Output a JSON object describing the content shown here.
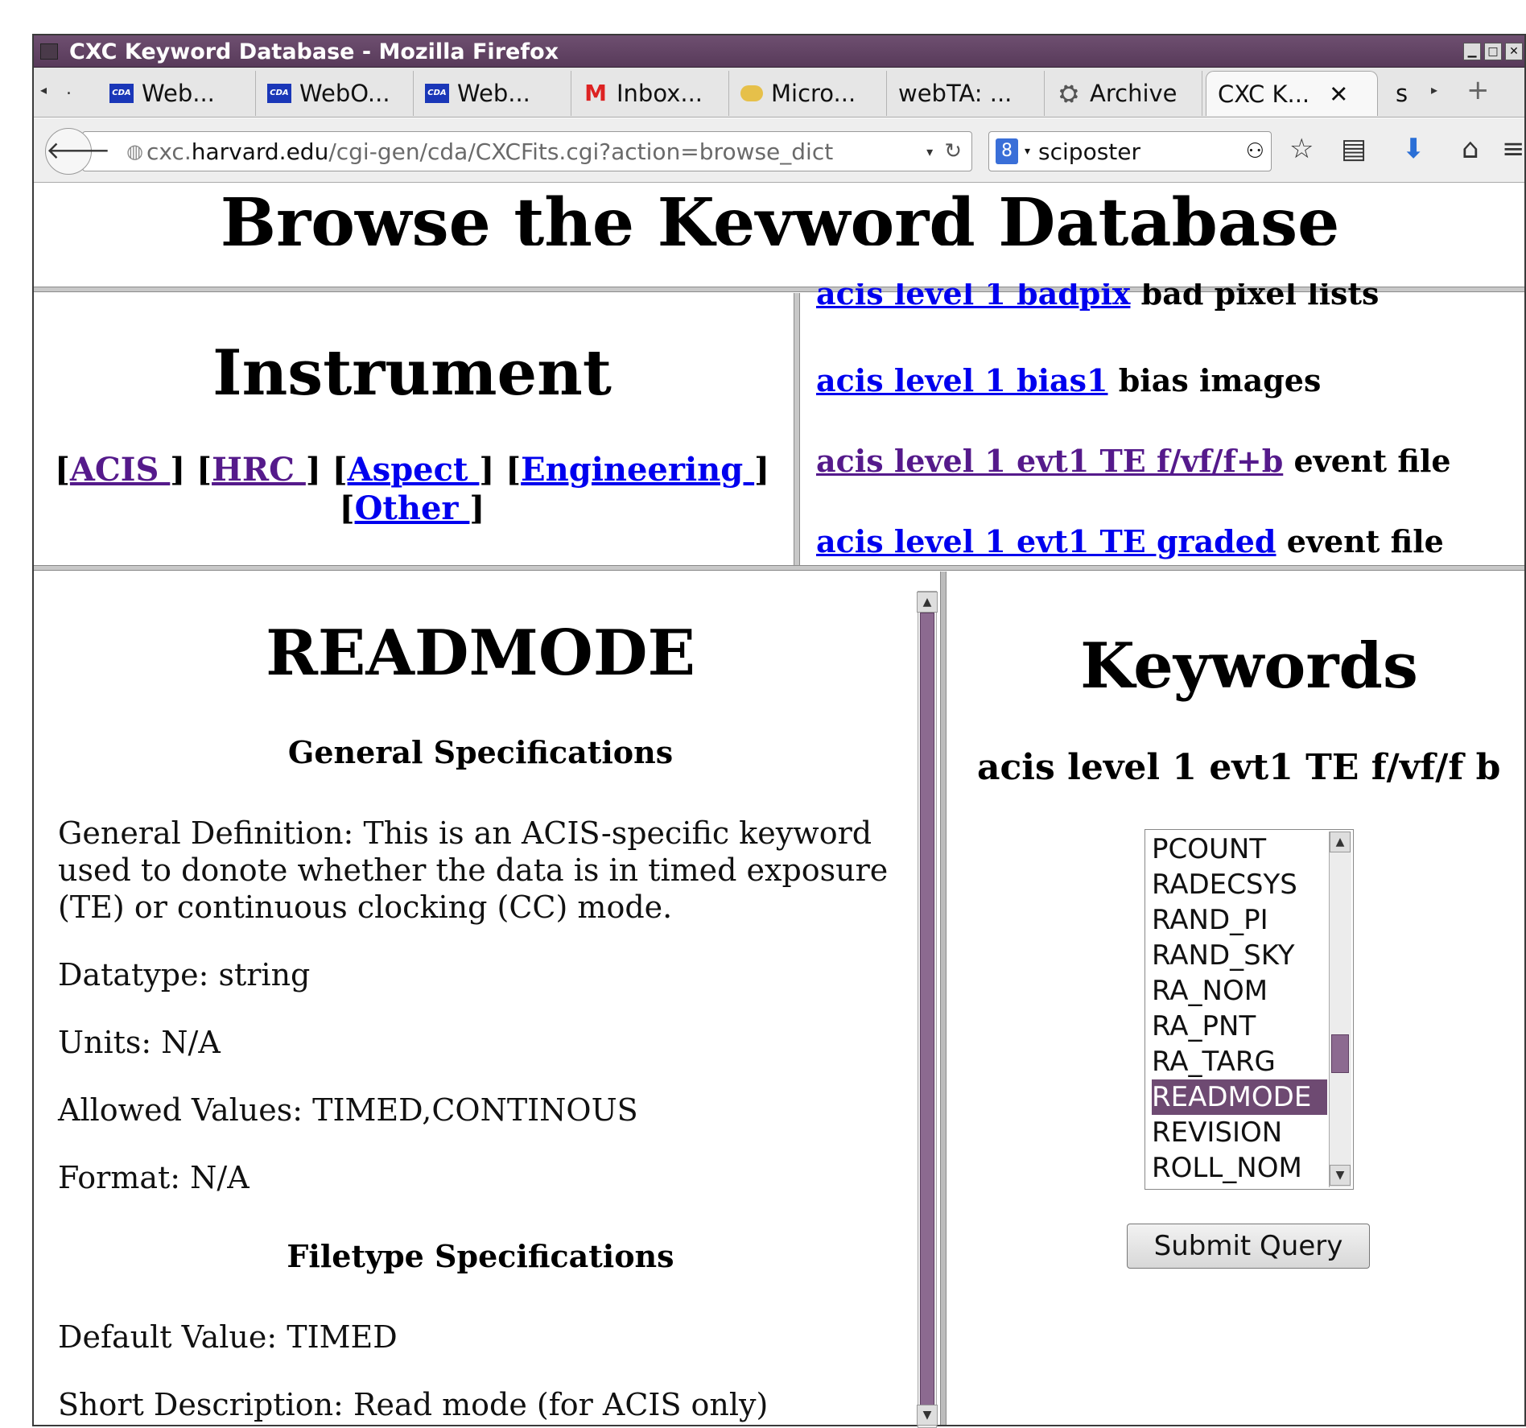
{
  "window": {
    "title": "CXC Keyword Database - Mozilla Firefox"
  },
  "tabs": [
    {
      "label": "Web...",
      "icon": "CDA"
    },
    {
      "label": "WebO...",
      "icon": "CDA"
    },
    {
      "label": "Web...",
      "icon": "CDA"
    },
    {
      "label": "Inbox...",
      "icon": "M"
    },
    {
      "label": "Micro...",
      "icon": "micro-icon"
    },
    {
      "label": "webTA: ...",
      "icon": ""
    },
    {
      "label": "Archive",
      "icon": "archive-icon"
    },
    {
      "label": "CXC K...",
      "icon": ""
    },
    {
      "label": "s",
      "icon": ""
    }
  ],
  "nav": {
    "url_prefix": "cxc.",
    "url_host": "harvard.edu",
    "url_path": "/cgi-gen/cda/CXCFits.cgi?action=browse_dict",
    "search_engine": "8",
    "search_value": "sciposter"
  },
  "top": {
    "title": "Browse the Keyword Database"
  },
  "instrument": {
    "title": "Instrument",
    "links": [
      "ACIS ",
      "HRC ",
      "Aspect ",
      "Engineering ",
      "Other "
    ]
  },
  "filetypes": [
    {
      "link": "acis level 1 badpix",
      "desc": " bad pixel lists"
    },
    {
      "link": "acis level 1 bias1",
      "desc": " bias images"
    },
    {
      "link": "acis level 1 evt1 TE f/vf/f+b",
      "desc": " event file"
    },
    {
      "link": "acis level 1 evt1 TE graded",
      "desc": " event file"
    }
  ],
  "keyword_detail": {
    "title": "READMODE",
    "general_heading": "General Specifications",
    "definition": "General Definition: This is an ACIS-specific keyword used to donote whether the data is in timed exposure (TE) or continuous clocking (CC) mode.",
    "datatype": "Datatype: string",
    "units": "Units: N/A",
    "allowed": "Allowed Values: TIMED,CONTINOUS",
    "format": "Format: N/A",
    "filetype_heading": "Filetype Specifications",
    "default": "Default Value: TIMED",
    "short_desc": "Short Description: Read mode (for ACIS only)"
  },
  "keywords_panel": {
    "title": "Keywords",
    "file": "acis level 1 evt1 TE f/vf/f b",
    "items": [
      "PCOUNT",
      "RADECSYS",
      "RAND_PI",
      "RAND_SKY",
      "RA_NOM",
      "RA_PNT",
      "RA_TARG",
      "READMODE",
      "REVISION",
      "ROLL_NOM"
    ],
    "selected": "READMODE",
    "submit_label": "Submit Query"
  }
}
